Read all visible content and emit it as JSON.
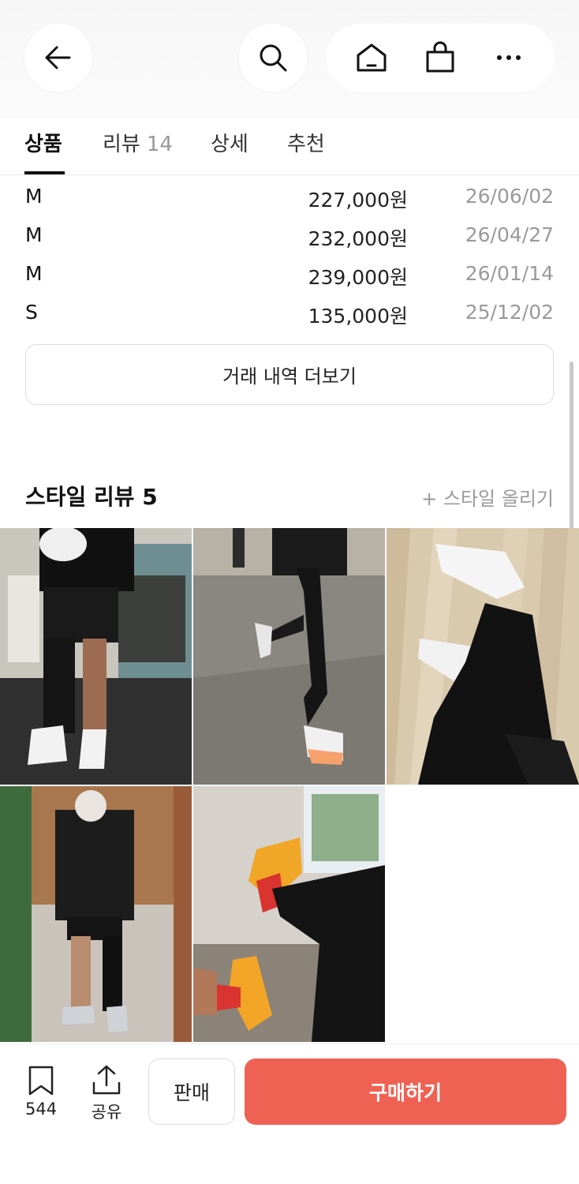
{
  "header": {
    "icons": [
      "back-arrow-icon",
      "search-icon",
      "home-icon",
      "shopping-bag-icon",
      "more-dots-icon"
    ]
  },
  "tabs": [
    {
      "label": "상품",
      "active": true
    },
    {
      "label": "리뷰",
      "count": "14"
    },
    {
      "label": "상세"
    },
    {
      "label": "추천"
    }
  ],
  "transactions": [
    {
      "size": "M",
      "price": "227,000원",
      "date": "26/06/02"
    },
    {
      "size": "M",
      "price": "232,000원",
      "date": "26/04/27"
    },
    {
      "size": "M",
      "price": "239,000원",
      "date": "26/01/14"
    },
    {
      "size": "S",
      "price": "135,000원",
      "date": "25/12/02"
    }
  ],
  "more_transactions_label": "거래 내역 더보기",
  "style_review": {
    "title": "스타일 리뷰 5",
    "upload_label": "+ 스타일 올리기"
  },
  "bottom_bar": {
    "bookmark_count": "544",
    "share_label": "공유",
    "sell_label": "판매",
    "buy_label": "구매하기",
    "accent_color": "#ef6253"
  }
}
